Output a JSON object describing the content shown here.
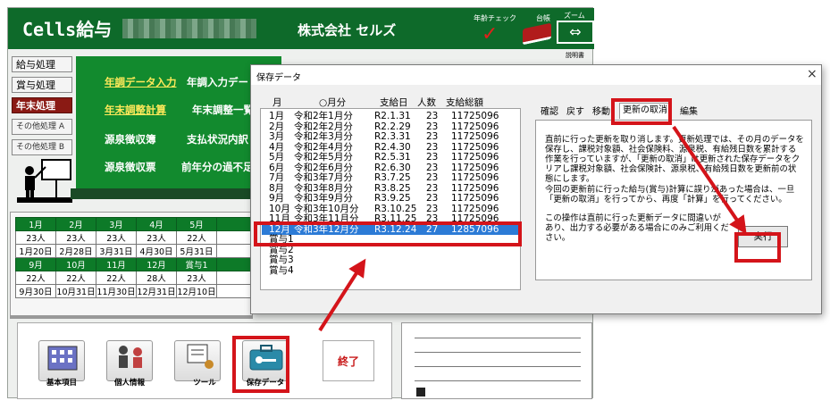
{
  "app": {
    "logo": "Cells給与",
    "company": "株式会社 セルズ",
    "age_check": "年齢チェック",
    "age_check_mark": "✓",
    "ledger": "台帳",
    "zoom": "ズーム",
    "zoom_icon": "⇔",
    "manual": "説明書"
  },
  "sidebar": {
    "items": [
      {
        "label": "給与処理"
      },
      {
        "label": "賞与処理"
      },
      {
        "label": "年末処理"
      },
      {
        "label": "その他処理 A"
      },
      {
        "label": "その他処理 B"
      }
    ]
  },
  "menu": {
    "row1": {
      "a": "年調データ入力",
      "b": "年調入力デー"
    },
    "row2": {
      "a": "年末調整計算",
      "b": "年末調整一覧"
    },
    "row3": {
      "a": "源泉徴収簿",
      "b": "支払状況内訳"
    },
    "row4": {
      "a": "源泉徴収票",
      "b": "前年分の過不足"
    }
  },
  "calendar": {
    "row1_months": [
      "1月",
      "2月",
      "3月",
      "4月",
      "5月",
      ""
    ],
    "row1_counts": [
      "23人",
      "23人",
      "23人",
      "23人",
      "22人",
      ""
    ],
    "row1_dates": [
      "1月20日",
      "2月28日",
      "3月31日",
      "4月30日",
      "5月31日",
      ""
    ],
    "row2_months": [
      "9月",
      "10月",
      "11月",
      "12月",
      "賞与1",
      ""
    ],
    "row2_counts": [
      "22人",
      "22人",
      "22人",
      "28人",
      "23人",
      ""
    ],
    "row2_dates": [
      "9月30日",
      "10月31日",
      "11月30日",
      "12月31日",
      "12月10日",
      ""
    ]
  },
  "tiles": {
    "basic": "基本項目",
    "personal": "個人情報",
    "tools": "ツール",
    "saved": "保存データ",
    "exit": "終了"
  },
  "dialog": {
    "title": "保存データ",
    "close": "×",
    "headers": {
      "month": "月",
      "period": "○月分",
      "pay_date": "支給日",
      "count": "人数",
      "total": "支給総額"
    },
    "rows": [
      {
        "m": "1月",
        "p": "令和2年1月分",
        "d": "R2.1.31",
        "n": "23",
        "t": "11725096"
      },
      {
        "m": "2月",
        "p": "令和2年2月分",
        "d": "R2.2.29",
        "n": "23",
        "t": "11725096"
      },
      {
        "m": "3月",
        "p": "令和2年3月分",
        "d": "R2.3.31",
        "n": "23",
        "t": "11725096"
      },
      {
        "m": "4月",
        "p": "令和2年4月分",
        "d": "R2.4.30",
        "n": "23",
        "t": "11725096"
      },
      {
        "m": "5月",
        "p": "令和2年5月分",
        "d": "R2.5.31",
        "n": "23",
        "t": "11725096"
      },
      {
        "m": "6月",
        "p": "令和2年6月分",
        "d": "R2.6.30",
        "n": "23",
        "t": "11725096"
      },
      {
        "m": "7月",
        "p": "令和3年7月分",
        "d": "R3.7.25",
        "n": "23",
        "t": "11725096"
      },
      {
        "m": "8月",
        "p": "令和3年8月分",
        "d": "R3.8.25",
        "n": "23",
        "t": "11725096"
      },
      {
        "m": "9月",
        "p": "令和3年9月分",
        "d": "R3.9.25",
        "n": "23",
        "t": "11725096"
      },
      {
        "m": "10月",
        "p": "令和3年10月分",
        "d": "R3.10.25",
        "n": "23",
        "t": "11725096"
      },
      {
        "m": "11月",
        "p": "令和3年11月分",
        "d": "R3.11.25",
        "n": "23",
        "t": "11725096"
      },
      {
        "m": "12月",
        "p": "令和3年12月分",
        "d": "R3.12.24",
        "n": "27",
        "t": "12857096"
      },
      {
        "m": "賞与1",
        "p": "",
        "d": "",
        "n": "",
        "t": ""
      },
      {
        "m": "賞与2",
        "p": "",
        "d": "",
        "n": "",
        "t": ""
      },
      {
        "m": "賞与3",
        "p": "",
        "d": "",
        "n": "",
        "t": ""
      },
      {
        "m": "賞与4",
        "p": "",
        "d": "",
        "n": "",
        "t": ""
      }
    ],
    "selected_row": 11,
    "tabs": [
      "確認",
      "戻す",
      "移動",
      "更新の取消",
      "編集"
    ],
    "active_tab": "更新の取消",
    "panel": {
      "para1": "直前に行った更新を取り消します。更新処理では、その月のデータを保存し、課税対象額、社会保険料、源泉税、有給残日数を累計する作業を行っていますが、「更新の取消」は更新された保存データをクリアし課税対象額、社会保険計、源泉税、有給残日数を更新前の状態にします。",
      "para2": "今回の更新前に行った給与(賞与)計算に誤りがあった場合は、一旦「更新の取消」を行ってから、再度「計算」を行ってください。",
      "para3": "この操作は直前に行った更新データに間違いがあり、出力する必要がある場合にのみご利用ください。",
      "execute": "実行"
    }
  },
  "colors": {
    "accent_red": "#d4141a",
    "header_green": "#0e6a2a",
    "selection_blue": "#2c7bd6"
  }
}
